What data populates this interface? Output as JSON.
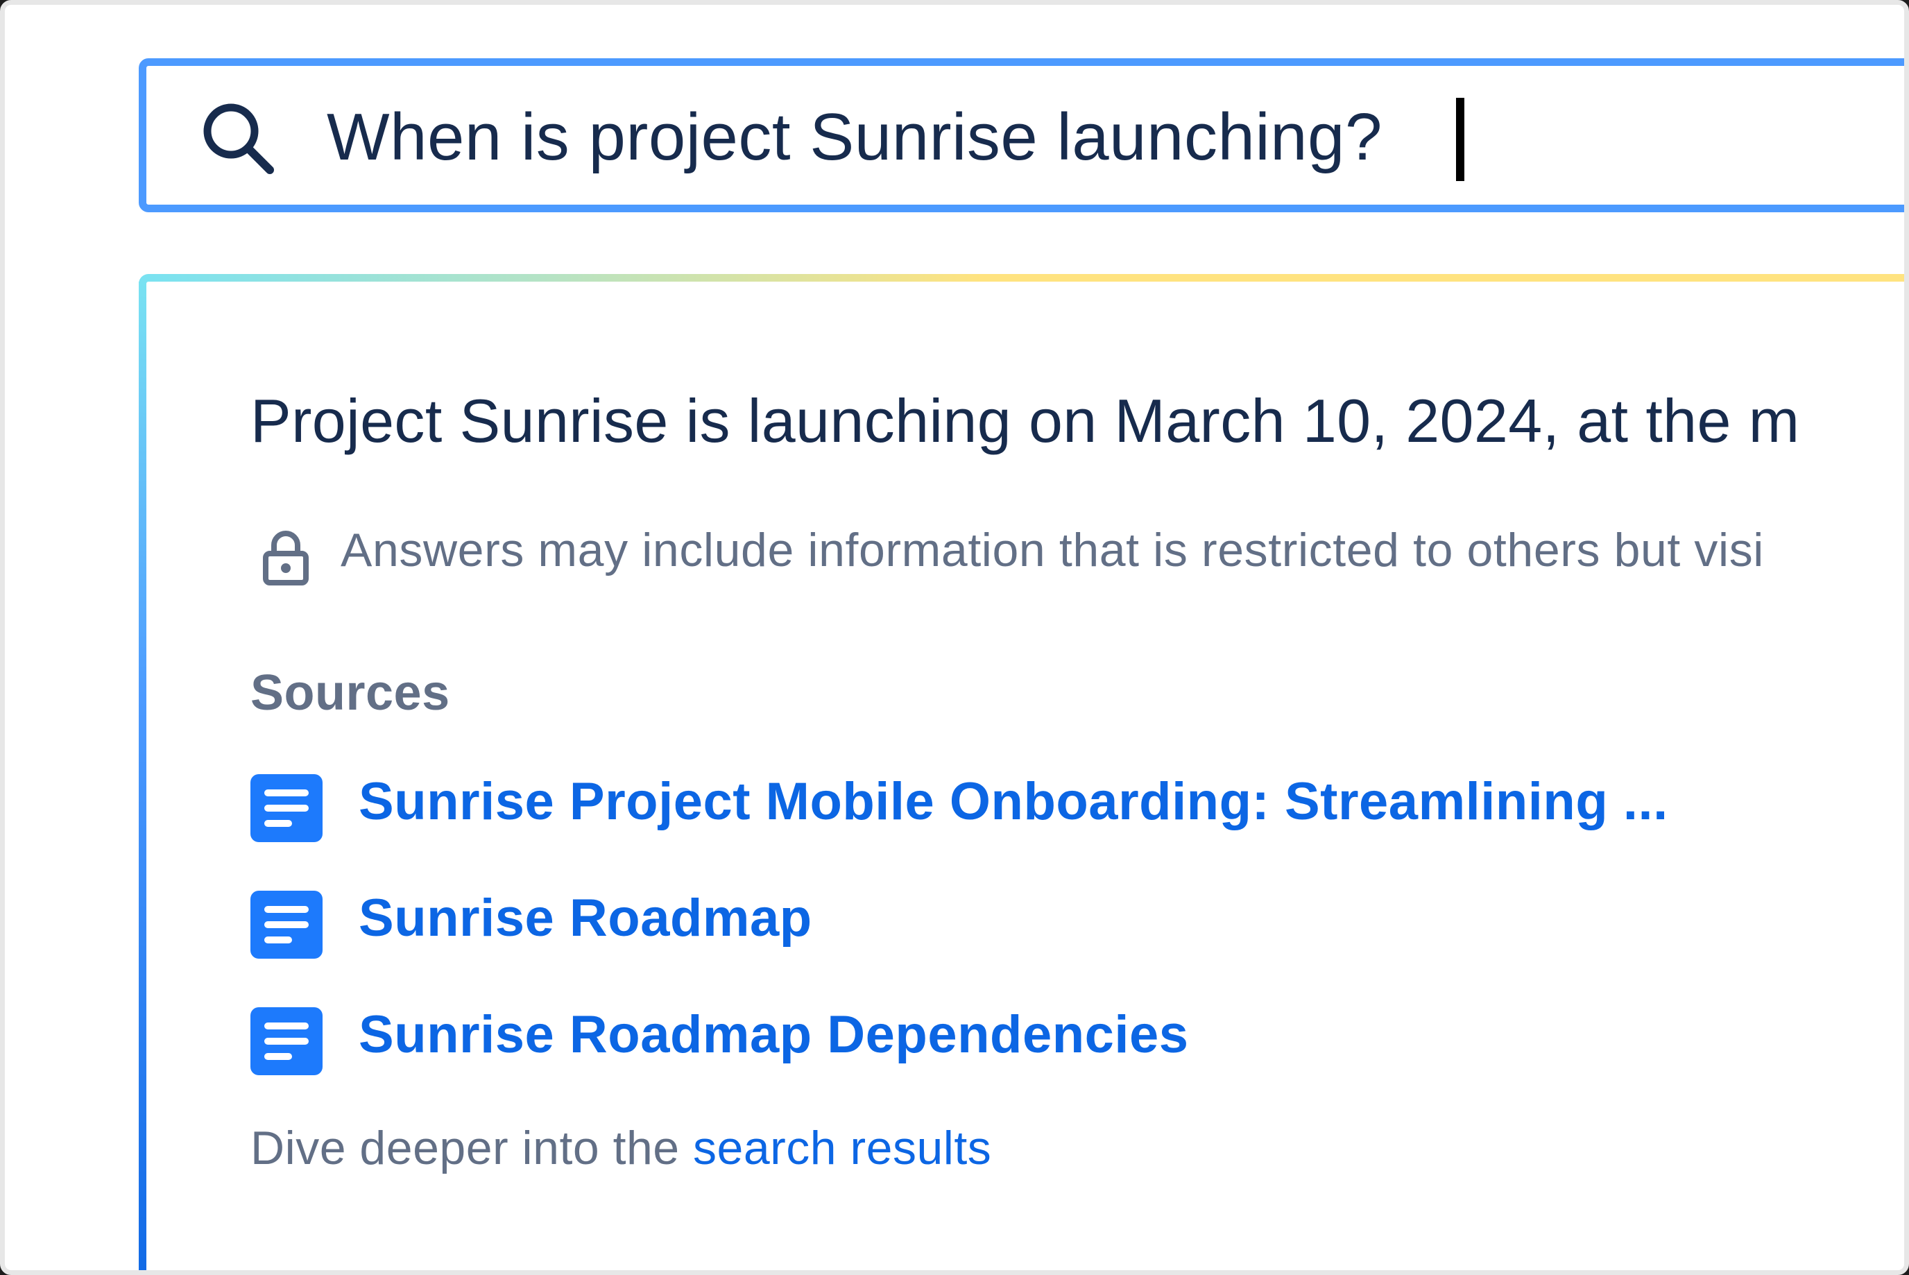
{
  "search": {
    "query": "When is project Sunrise launching?",
    "icon": "search-icon"
  },
  "answer": {
    "text": "Project Sunrise is launching on March 10, 2024, at the m",
    "notice": "Answers may include information that is restricted to others but visi",
    "notice_icon": "lock-icon"
  },
  "sources": {
    "heading": "Sources",
    "items": [
      {
        "label": "Sunrise Project Mobile Onboarding: Streamlining ...",
        "icon": "document-icon"
      },
      {
        "label": "Sunrise Roadmap",
        "icon": "document-icon"
      },
      {
        "label": "Sunrise Roadmap Dependencies",
        "icon": "document-icon"
      }
    ]
  },
  "footer": {
    "prefix": "Dive deeper into the ",
    "link_label": "search results"
  },
  "colors": {
    "search_border": "#4c9aff",
    "link": "#0c66e4",
    "text_primary": "#172b4d",
    "text_secondary": "#626f86",
    "gradient_start": "#79e2f2",
    "gradient_end": "#ffe380"
  }
}
